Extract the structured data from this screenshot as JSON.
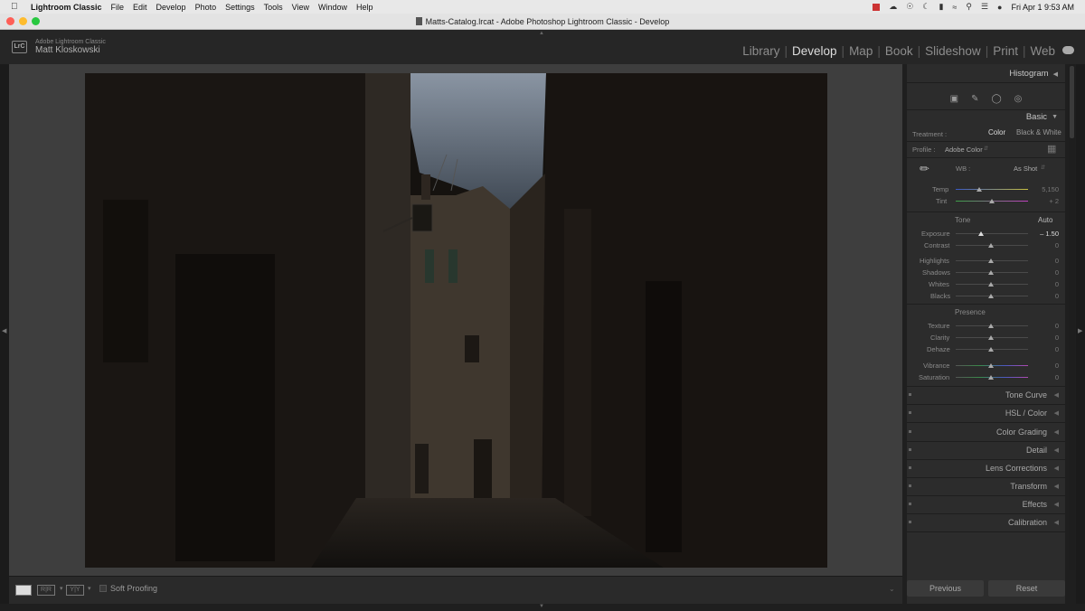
{
  "menubar": {
    "app": "Lightroom Classic",
    "items": [
      "File",
      "Edit",
      "Develop",
      "Photo",
      "Settings",
      "Tools",
      "View",
      "Window",
      "Help"
    ],
    "datetime": "Fri Apr 1  9:53 AM"
  },
  "window": {
    "title": "Matts-Catalog.lrcat - Adobe Photoshop Lightroom Classic - Develop"
  },
  "identity": {
    "product": "Adobe Lightroom Classic",
    "user": "Matt Kloskowski",
    "logo": "LrC"
  },
  "modules": [
    {
      "label": "Library",
      "active": false
    },
    {
      "label": "Develop",
      "active": true
    },
    {
      "label": "Map",
      "active": false
    },
    {
      "label": "Book",
      "active": false
    },
    {
      "label": "Slideshow",
      "active": false
    },
    {
      "label": "Print",
      "active": false
    },
    {
      "label": "Web",
      "active": false
    }
  ],
  "filmstrip": {
    "soft_proofing": "Soft Proofing"
  },
  "panel": {
    "histogram": "Histogram",
    "basic": "Basic",
    "treatment": {
      "label": "Treatment :",
      "color": "Color",
      "bw": "Black & White"
    },
    "profile": {
      "label": "Profile :",
      "value": "Adobe Color"
    },
    "wb": {
      "label": "WB :",
      "value": "As Shot"
    },
    "temp": {
      "label": "Temp",
      "value": "5,150",
      "position": 0.27
    },
    "tint": {
      "label": "Tint",
      "value": "+ 2",
      "position": 0.51
    },
    "tone": {
      "label": "Tone",
      "auto": "Auto"
    },
    "exposure": {
      "label": "Exposure",
      "value": "– 1.50",
      "position": 0.35
    },
    "contrast": {
      "label": "Contrast",
      "value": "0",
      "position": 0.5
    },
    "highlights": {
      "label": "Highlights",
      "value": "0",
      "position": 0.5
    },
    "shadows": {
      "label": "Shadows",
      "value": "0",
      "position": 0.5
    },
    "whites": {
      "label": "Whites",
      "value": "0",
      "position": 0.5
    },
    "blacks": {
      "label": "Blacks",
      "value": "0",
      "position": 0.5
    },
    "presence": "Presence",
    "texture": {
      "label": "Texture",
      "value": "0",
      "position": 0.5
    },
    "clarity": {
      "label": "Clarity",
      "value": "0",
      "position": 0.5
    },
    "dehaze": {
      "label": "Dehaze",
      "value": "0",
      "position": 0.5
    },
    "vibrance": {
      "label": "Vibrance",
      "value": "0",
      "position": 0.5
    },
    "saturation": {
      "label": "Saturation",
      "value": "0",
      "position": 0.5
    },
    "collapsed": [
      "Tone Curve",
      "HSL / Color",
      "Color Grading",
      "Detail",
      "Lens Corrections",
      "Transform",
      "Effects",
      "Calibration"
    ],
    "previous": "Previous",
    "reset": "Reset"
  },
  "colors": {
    "accent_active": "#dddddd",
    "panel_bg": "#2c2c2c",
    "canvas_bg": "#3e3e3e"
  }
}
